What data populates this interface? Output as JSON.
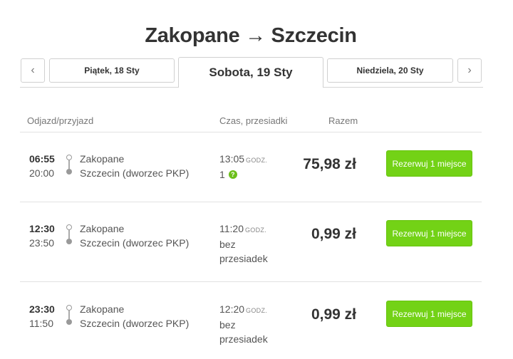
{
  "header": {
    "title": "Zakopane → Szczecin"
  },
  "date_nav": {
    "prev_symbol": "‹",
    "next_symbol": "›",
    "days": [
      {
        "label": "Piątek, 18 Sty",
        "active": false
      },
      {
        "label": "Sobota, 19 Sty",
        "active": true
      },
      {
        "label": "Niedziela, 20 Sty",
        "active": false
      }
    ]
  },
  "columns": {
    "departure_arrival": "Odjazd/przyjazd",
    "duration_changes": "Czas, przesiadki",
    "total": "Razem"
  },
  "connections": [
    {
      "departure": "06:55",
      "arrival": "20:00",
      "from": "Zakopane",
      "to": "Szczecin (dworzec PKP)",
      "duration": "13:05",
      "duration_unit": "GODZ.",
      "changes_line1": "1",
      "changes_line2": "",
      "has_help_icon": true,
      "price": "75,98 zł",
      "button": "Rezerwuj 1 miejsce"
    },
    {
      "departure": "12:30",
      "arrival": "23:50",
      "from": "Zakopane",
      "to": "Szczecin (dworzec PKP)",
      "duration": "11:20",
      "duration_unit": "GODZ.",
      "changes_line1": "bez",
      "changes_line2": "przesiadek",
      "has_help_icon": false,
      "price": "0,99 zł",
      "button": "Rezerwuj 1 miejsce"
    },
    {
      "departure": "23:30",
      "arrival": "11:50",
      "from": "Zakopane",
      "to": "Szczecin (dworzec PKP)",
      "duration": "12:20",
      "duration_unit": "GODZ.",
      "changes_line1": "bez",
      "changes_line2": "przesiadek",
      "has_help_icon": false,
      "price": "0,99 zł",
      "button": "Rezerwuj 1 miejsce"
    }
  ],
  "colors": {
    "accent_green": "#73d216",
    "text_dark": "#333333",
    "text_muted": "#777777"
  }
}
